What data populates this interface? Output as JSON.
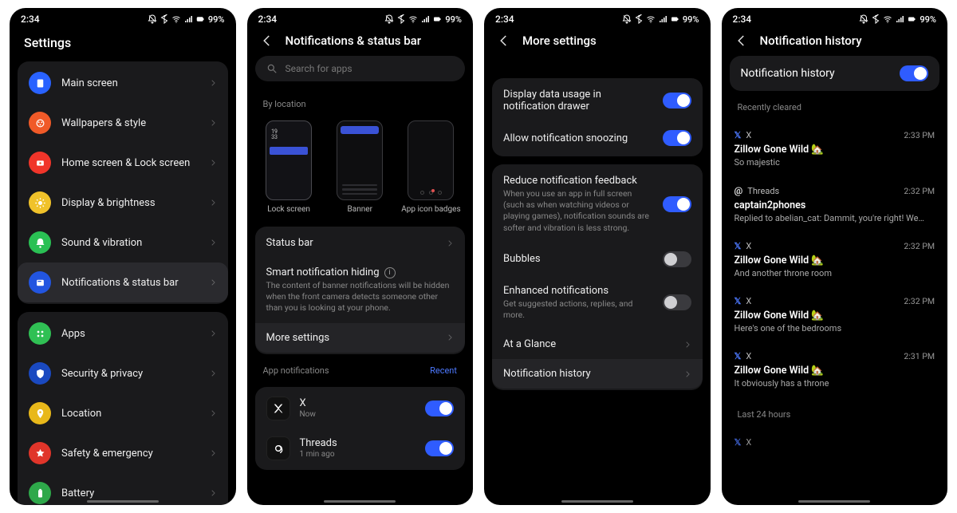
{
  "status": {
    "time": "2:34",
    "battery": "99%"
  },
  "colors": {
    "blue": "#2962ff",
    "green_bright": "#30c054",
    "orange": "#f05a28",
    "red": "#f0352a",
    "yellow": "#f0c22a",
    "green": "#2ac054",
    "blue_mid": "#2255e0",
    "blue_dark": "#1a49c0",
    "yellow2": "#e8b81a",
    "red_star": "#e0352a",
    "green2": "#2ea84a",
    "gray": "#3a3a40"
  },
  "s1": {
    "title": "Settings",
    "group1": [
      {
        "id": "main-screen",
        "label": "Main screen",
        "color": "blue"
      },
      {
        "id": "wallpapers-style",
        "label": "Wallpapers & style",
        "color": "orange"
      },
      {
        "id": "home-lock",
        "label": "Home screen & Lock screen",
        "color": "red"
      },
      {
        "id": "display-brightness",
        "label": "Display & brightness",
        "color": "yellow"
      },
      {
        "id": "sound-vibration",
        "label": "Sound & vibration",
        "color": "green"
      },
      {
        "id": "notifications-status",
        "label": "Notifications & status bar",
        "color": "blue_mid",
        "selected": true
      }
    ],
    "group2": [
      {
        "id": "apps",
        "label": "Apps",
        "color": "green_bright"
      },
      {
        "id": "security-privacy",
        "label": "Security & privacy",
        "color": "blue_dark"
      },
      {
        "id": "location",
        "label": "Location",
        "color": "yellow2"
      },
      {
        "id": "safety-emergency",
        "label": "Safety & emergency",
        "color": "red_star"
      },
      {
        "id": "battery",
        "label": "Battery",
        "color": "green2"
      }
    ]
  },
  "s2": {
    "title": "Notifications & status bar",
    "search_placeholder": "Search for apps",
    "by_location_label": "By location",
    "loc_tiles": [
      {
        "id": "lock-screen",
        "label": "Lock screen"
      },
      {
        "id": "banner",
        "label": "Banner"
      },
      {
        "id": "app-icon-badges",
        "label": "App icon badges"
      }
    ],
    "rows": {
      "status_bar": "Status bar",
      "smart_hiding": "Smart notification hiding",
      "smart_hiding_sub": "The content of banner notifications will be hidden when the front camera detects someone other than you is looking at your phone.",
      "more_settings": "More settings"
    },
    "app_notifs_label": "App notifications",
    "recent_label": "Recent",
    "apps": [
      {
        "name": "X",
        "time": "Now",
        "on": true,
        "icon": "x"
      },
      {
        "name": "Threads",
        "time": "1 min ago",
        "on": true,
        "icon": "threads"
      }
    ]
  },
  "s3": {
    "title": "More settings",
    "rows1": [
      {
        "id": "data-usage",
        "label": "Display data usage in notification drawer",
        "toggle": true,
        "on": true
      },
      {
        "id": "snoozing",
        "label": "Allow notification snoozing",
        "toggle": true,
        "on": true
      }
    ],
    "rows2": [
      {
        "id": "reduce-feedback",
        "label": "Reduce notification feedback",
        "sub": "When you use an app in full screen (such as when watching videos or playing games), notification sounds are softer and vibration is less strong.",
        "toggle": true,
        "on": true
      },
      {
        "id": "bubbles",
        "label": "Bubbles",
        "toggle": true,
        "on": false
      },
      {
        "id": "enhanced",
        "label": "Enhanced notifications",
        "sub": "Get suggested actions, replies, and more.",
        "toggle": true,
        "on": false
      },
      {
        "id": "at-a-glance",
        "label": "At a Glance",
        "toggle": false
      },
      {
        "id": "notif-history",
        "label": "Notification history",
        "toggle": false,
        "highlight": true
      }
    ]
  },
  "s4": {
    "title": "Notification history",
    "toggle_label": "Notification history",
    "sections": {
      "recent": "Recently cleared",
      "last24": "Last 24 hours"
    },
    "items": [
      {
        "app": "X",
        "glyph": "x",
        "title": "Zillow Gone Wild 🏡",
        "body": "So majestic",
        "time": "2:33 PM"
      },
      {
        "app": "Threads",
        "glyph": "threads",
        "title": "captain2phones",
        "body": "Replied to abelian_cat: Dammit, you're right! We…",
        "time": "2:32 PM"
      },
      {
        "app": "X",
        "glyph": "x",
        "title": "Zillow Gone Wild 🏡",
        "body": "And another throne room",
        "time": "2:32 PM"
      },
      {
        "app": "X",
        "glyph": "x",
        "title": "Zillow Gone Wild 🏡",
        "body": "Here's one of the bedrooms",
        "time": "2:32 PM"
      },
      {
        "app": "X",
        "glyph": "x",
        "title": "Zillow Gone Wild 🏡",
        "body": "It obviously has a throne",
        "time": "2:31 PM"
      }
    ],
    "last24_preview": {
      "app": "X",
      "glyph": "x"
    }
  }
}
